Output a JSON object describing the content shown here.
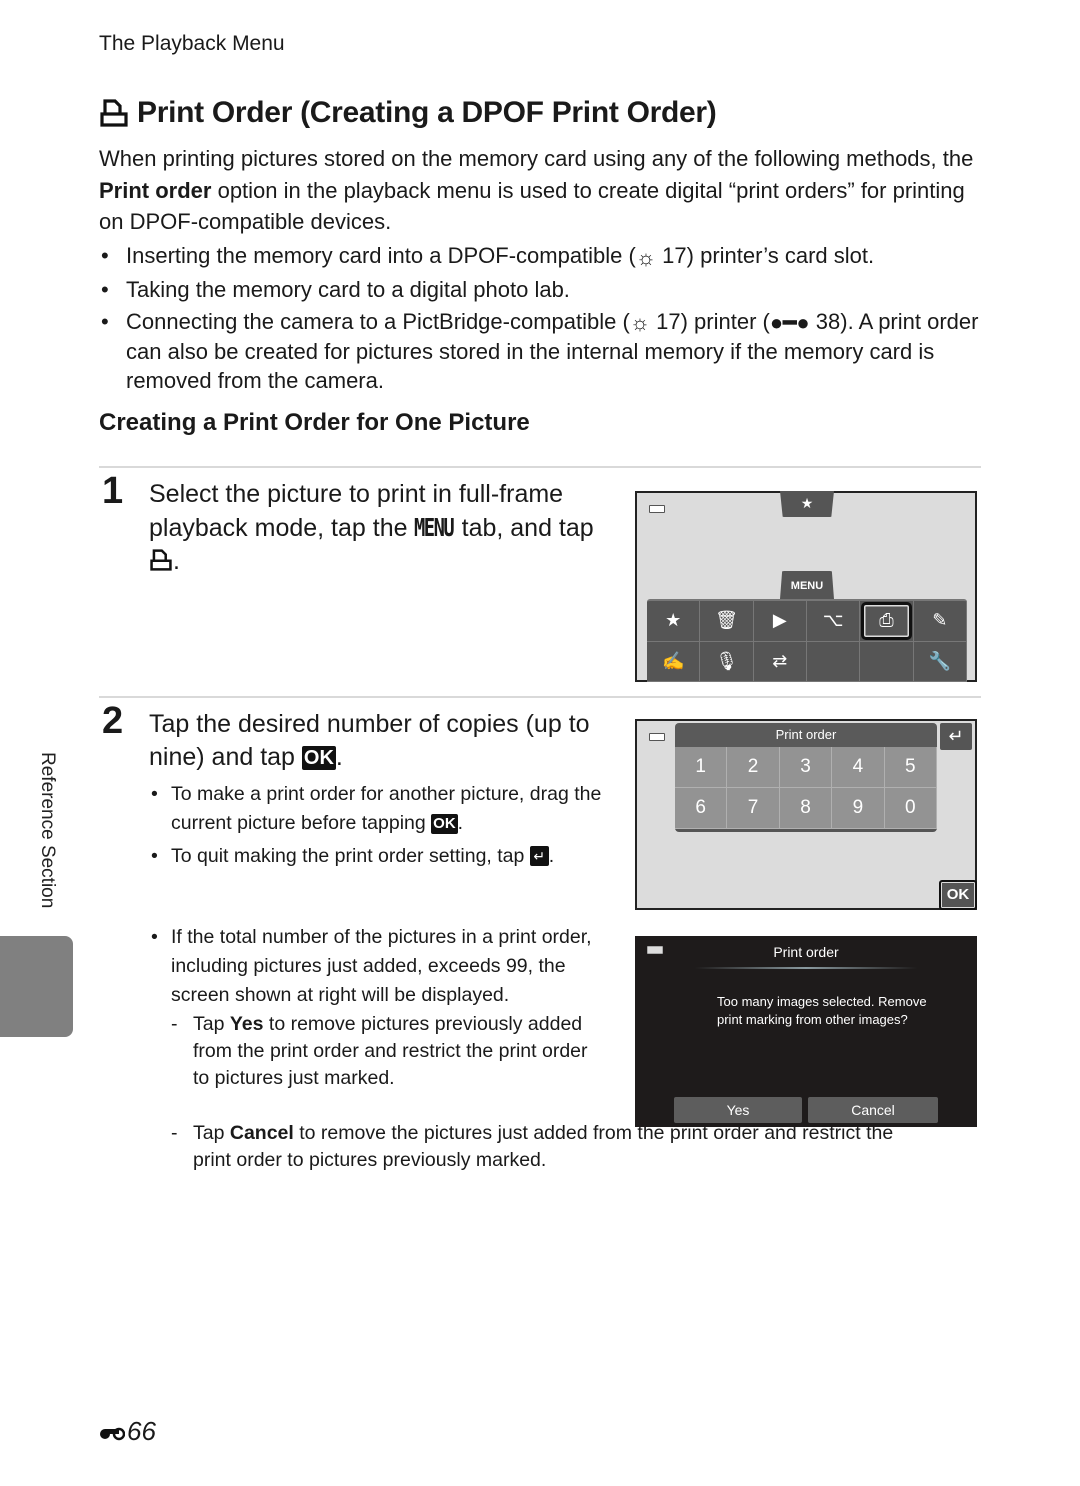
{
  "running_head": "The Playback Menu",
  "title": {
    "icon": "print-order-icon",
    "text": "Print Order (Creating a DPOF Print Order)"
  },
  "intro": {
    "before": "When printing pictures stored on the memory card using any of the following methods, the ",
    "bold": "Print order",
    "after": " option in the playback menu is used to create digital “print orders” for printing on DPOF-compatible devices."
  },
  "methods": [
    {
      "before": "Inserting the memory card into a DPOF-compatible (",
      "ref_icon": "tip-icon",
      "ref": "17",
      "after": ") printer’s card slot."
    },
    {
      "before": "Taking the memory card to a digital photo lab.",
      "ref_icon": "",
      "ref": "",
      "after": ""
    },
    {
      "before": "Connecting the camera to a PictBridge-compatible (",
      "ref_icon": "tip-icon",
      "ref": "17",
      "after": ") printer (",
      "ref2_icon": "reference-binoculars-icon",
      "ref2": "38",
      "after2": "). A print order can also be created for pictures stored in the internal memory if the memory card is removed from the camera."
    }
  ],
  "section_heading": "Creating a Print Order for One Picture",
  "steps": [
    {
      "number": "1",
      "text_a": "Select the picture to print in full-frame playback mode, tap the ",
      "menu_word": "MENU",
      "text_b": " tab, and tap ",
      "text_c": "."
    },
    {
      "number": "2",
      "text_a": "Tap the desired number of copies (up to nine) and tap ",
      "ok": "OK",
      "text_b": ".",
      "notes": [
        {
          "text": "To make a print order for another picture, drag the current picture before tapping ",
          "badge": "OK",
          "end": "."
        },
        {
          "text": "To quit making the print order setting, tap ",
          "badge": "↵",
          "end": "."
        }
      ]
    }
  ],
  "overflow_note": {
    "text": "If the total number of the pictures in a print order, including pictures just added, exceeds 99, the screen shown at right will be displayed.",
    "options": [
      {
        "prefix": "Tap ",
        "bold": "Yes",
        "rest": " to remove pictures previously added from the print order and restrict the print order to pictures just marked."
      },
      {
        "prefix": "Tap ",
        "bold": "Cancel",
        "rest": " to remove the pictures just added from the print order and restrict the print order to pictures previously marked."
      }
    ]
  },
  "screen_menu": {
    "top_tab_icon": "★",
    "menu_tab": "MENU",
    "items": [
      {
        "name": "favorite-pictures",
        "glyph": "★"
      },
      {
        "name": "delete",
        "glyph": "🗑"
      },
      {
        "name": "slide-show",
        "glyph": "▶"
      },
      {
        "name": "protect",
        "glyph": "⌥"
      },
      {
        "name": "print-order",
        "glyph": "⎙",
        "selected": true
      },
      {
        "name": "edit",
        "glyph": "✎"
      },
      {
        "name": "voice-memo-edit",
        "glyph": "✍"
      },
      {
        "name": "voice-memo",
        "glyph": "🎙"
      },
      {
        "name": "copy",
        "glyph": "⇄"
      },
      {
        "name": "empty-1",
        "glyph": ""
      },
      {
        "name": "empty-2",
        "glyph": ""
      },
      {
        "name": "setup",
        "glyph": "🔧"
      }
    ]
  },
  "screen_keypad": {
    "title": "Print order",
    "keys": [
      "1",
      "2",
      "3",
      "4",
      "5",
      "6",
      "7",
      "8",
      "9",
      "0"
    ],
    "back_label": "↵",
    "ok_label": "OK"
  },
  "screen_dialog": {
    "title": "Print order",
    "message": "Too many images selected. Remove print marking from other images?",
    "yes": "Yes",
    "cancel": "Cancel"
  },
  "side_tab": "Reference Section",
  "page_number": "66"
}
